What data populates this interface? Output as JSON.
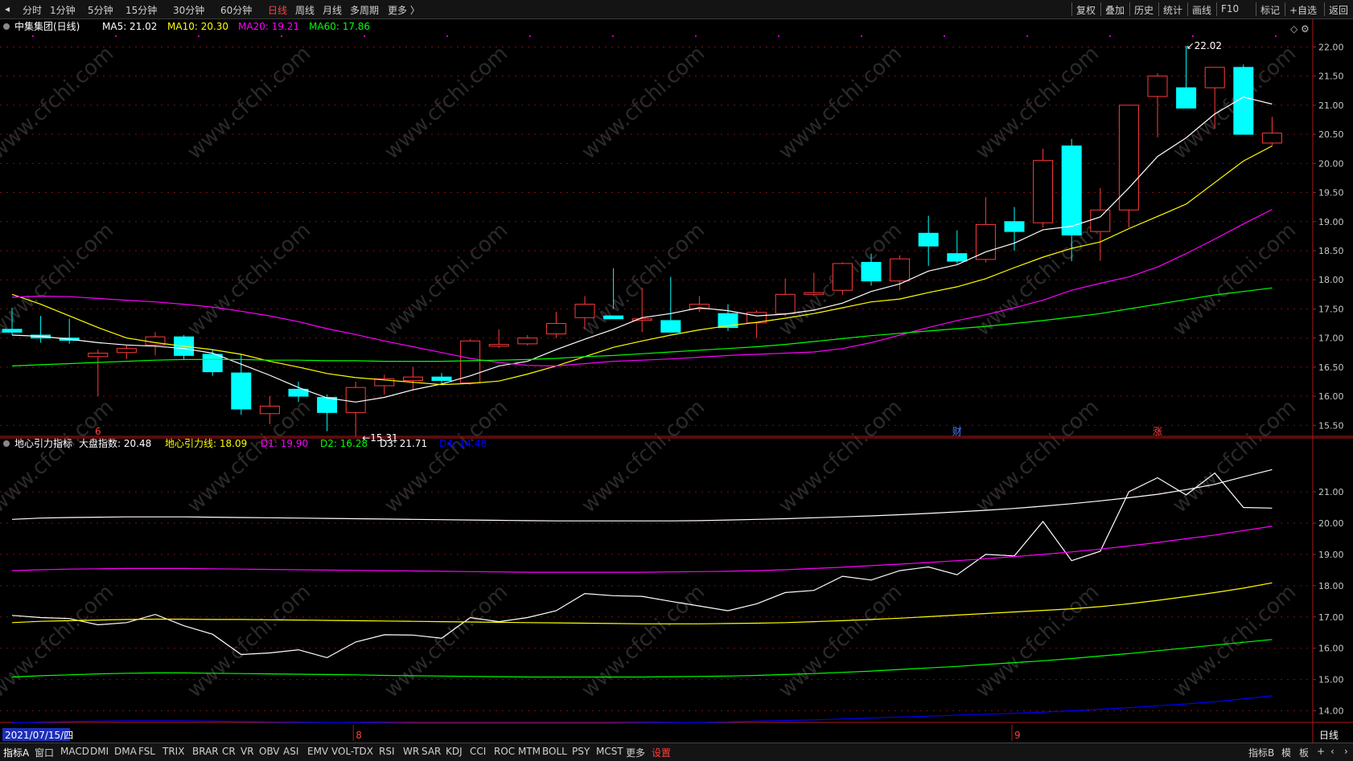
{
  "toolbar": {
    "back_glyph": "◂",
    "periods": [
      "分时",
      "1分钟",
      "5分钟",
      "15分钟",
      "30分钟",
      "60分钟",
      "日线",
      "周线",
      "月线",
      "多周期",
      "更多 〉"
    ],
    "active_period": "日线",
    "tools": [
      "复权",
      "叠加",
      "历史",
      "统计",
      "画线",
      "F10",
      "标记",
      "+自选",
      "返回"
    ]
  },
  "colors": {
    "up": "#ff3b3b",
    "down": "#00ffff",
    "grid": "#7a1111",
    "border": "#b01818",
    "ma5": "#ffffff",
    "ma10": "#ffff00",
    "ma20": "#ff00ff",
    "ma60": "#00ff00",
    "dadi": "#ffffff",
    "dixin": "#ffff00",
    "d1": "#ff00ff",
    "d2": "#00ff00",
    "d3": "#ffffff",
    "d4": "#0000ff",
    "event_red": "#ff4040",
    "event_blue": "#4a7cff"
  },
  "chart_data": [
    {
      "type": "candlestick",
      "title": "中集集团(日线)",
      "ylim": [
        15.2,
        22.2
      ],
      "yticks": [
        "22.00",
        "21.50",
        "21.00",
        "20.50",
        "20.00",
        "19.50",
        "19.00",
        "18.50",
        "18.00",
        "17.50",
        "17.00",
        "16.50",
        "16.00",
        "15.50"
      ],
      "ohlc": [
        [
          17.15,
          17.52,
          17.05,
          17.1
        ],
        [
          17.05,
          17.38,
          16.92,
          17.0
        ],
        [
          17.0,
          17.33,
          16.9,
          16.96
        ],
        [
          16.68,
          16.8,
          16.0,
          16.74
        ],
        [
          16.75,
          16.88,
          16.64,
          16.82
        ],
        [
          16.88,
          17.1,
          16.7,
          17.02
        ],
        [
          17.02,
          17.05,
          16.62,
          16.7
        ],
        [
          16.72,
          16.8,
          16.35,
          16.42
        ],
        [
          16.4,
          16.72,
          15.68,
          15.78
        ],
        [
          15.7,
          16.0,
          15.52,
          15.83
        ],
        [
          16.12,
          16.25,
          15.9,
          16.0
        ],
        [
          15.98,
          16.03,
          15.4,
          15.72
        ],
        [
          15.72,
          16.25,
          15.31,
          16.15
        ],
        [
          16.18,
          16.37,
          16.03,
          16.3
        ],
        [
          16.27,
          16.5,
          16.1,
          16.33
        ],
        [
          16.33,
          16.4,
          16.22,
          16.27
        ],
        [
          16.23,
          16.98,
          16.2,
          16.95
        ],
        [
          16.86,
          17.15,
          16.83,
          16.89
        ],
        [
          16.9,
          17.05,
          16.87,
          17.0
        ],
        [
          17.07,
          17.45,
          17.0,
          17.25
        ],
        [
          17.35,
          17.72,
          17.15,
          17.58
        ],
        [
          17.38,
          18.2,
          17.5,
          17.33
        ],
        [
          17.33,
          17.86,
          17.1,
          17.33
        ],
        [
          17.3,
          18.05,
          17.26,
          17.1
        ],
        [
          17.5,
          17.72,
          17.45,
          17.58
        ],
        [
          17.42,
          17.58,
          17.12,
          17.18
        ],
        [
          17.26,
          17.48,
          17.0,
          17.44
        ],
        [
          17.42,
          18.02,
          17.38,
          17.75
        ],
        [
          17.75,
          18.12,
          17.72,
          17.78
        ],
        [
          17.82,
          18.3,
          17.74,
          18.28
        ],
        [
          18.3,
          18.45,
          17.9,
          17.98
        ],
        [
          17.98,
          18.42,
          17.82,
          18.36
        ],
        [
          18.8,
          19.1,
          18.24,
          18.58
        ],
        [
          18.45,
          18.85,
          18.28,
          18.32
        ],
        [
          18.35,
          19.42,
          18.3,
          18.95
        ],
        [
          19.0,
          19.25,
          18.5,
          18.83
        ],
        [
          18.98,
          20.25,
          18.9,
          20.05
        ],
        [
          20.3,
          20.42,
          18.32,
          18.77
        ],
        [
          18.83,
          19.58,
          18.33,
          19.2
        ],
        [
          19.2,
          21.0,
          18.9,
          21.0
        ],
        [
          21.15,
          21.55,
          20.45,
          21.5
        ],
        [
          21.3,
          22.02,
          20.95,
          20.95
        ],
        [
          21.3,
          21.65,
          20.6,
          21.65
        ],
        [
          21.65,
          21.7,
          20.5,
          20.5
        ],
        [
          20.35,
          20.8,
          20.3,
          20.52
        ]
      ],
      "series": [
        {
          "name": "MA5",
          "last": "21.02",
          "values": [
            17.05,
            17.03,
            16.98,
            16.92,
            16.88,
            16.86,
            16.82,
            16.74,
            16.55,
            16.36,
            16.15,
            15.97,
            15.9,
            15.98,
            16.11,
            16.21,
            16.35,
            16.52,
            16.6,
            16.8,
            16.98,
            17.15,
            17.35,
            17.42,
            17.52,
            17.47,
            17.38,
            17.41,
            17.48,
            17.6,
            17.8,
            17.93,
            18.15,
            18.26,
            18.48,
            18.63,
            18.86,
            18.92,
            19.08,
            19.58,
            20.12,
            20.44,
            20.85,
            21.14,
            21.02
          ]
        },
        {
          "name": "MA10",
          "last": "20.30",
          "values": [
            17.75,
            17.58,
            17.38,
            17.18,
            17.0,
            16.92,
            16.86,
            16.8,
            16.72,
            16.6,
            16.5,
            16.39,
            16.32,
            16.28,
            16.24,
            16.2,
            16.22,
            16.26,
            16.38,
            16.52,
            16.68,
            16.84,
            16.95,
            17.05,
            17.14,
            17.21,
            17.27,
            17.34,
            17.42,
            17.52,
            17.62,
            17.67,
            17.78,
            17.88,
            18.02,
            18.21,
            18.39,
            18.54,
            18.65,
            18.88,
            19.09,
            19.3,
            19.67,
            20.04,
            20.3
          ]
        },
        {
          "name": "MA20",
          "last": "19.21",
          "values": [
            17.7,
            17.72,
            17.71,
            17.68,
            17.65,
            17.62,
            17.58,
            17.53,
            17.46,
            17.38,
            17.28,
            17.16,
            17.06,
            16.95,
            16.85,
            16.75,
            16.65,
            16.58,
            16.53,
            16.52,
            16.56,
            16.6,
            16.62,
            16.64,
            16.67,
            16.7,
            16.72,
            16.74,
            16.76,
            16.82,
            16.92,
            17.05,
            17.18,
            17.3,
            17.4,
            17.52,
            17.65,
            17.82,
            17.94,
            18.05,
            18.22,
            18.45,
            18.7,
            18.96,
            19.21
          ]
        },
        {
          "name": "MA60",
          "last": "17.86",
          "values": [
            16.52,
            16.54,
            16.56,
            16.58,
            16.6,
            16.62,
            16.63,
            16.63,
            16.63,
            16.62,
            16.62,
            16.61,
            16.61,
            16.6,
            16.6,
            16.6,
            16.61,
            16.62,
            16.63,
            16.65,
            16.68,
            16.7,
            16.73,
            16.76,
            16.79,
            16.82,
            16.85,
            16.89,
            16.94,
            16.99,
            17.04,
            17.08,
            17.12,
            17.16,
            17.2,
            17.25,
            17.3,
            17.36,
            17.42,
            17.5,
            17.58,
            17.66,
            17.74,
            17.8,
            17.86
          ]
        }
      ],
      "annotations": {
        "high": "22.02",
        "low": "15.31",
        "high_marker": "↙",
        "low_marker": "←"
      },
      "events": [
        {
          "index": 3,
          "label": "6",
          "color": "event_red"
        },
        {
          "index": 33,
          "label": "财",
          "color": "event_blue"
        },
        {
          "index": 40,
          "label": "涨",
          "color": "event_red"
        }
      ]
    },
    {
      "type": "line",
      "title": "地心引力指标",
      "ylim": [
        13.5,
        21.9
      ],
      "yticks": [
        "21.00",
        "20.00",
        "19.00",
        "18.00",
        "17.00",
        "16.00",
        "15.00",
        "14.00"
      ],
      "series": [
        {
          "name": "大盘指数",
          "last": "20.48",
          "values": [
            17.05,
            16.98,
            16.95,
            16.75,
            16.82,
            17.08,
            16.72,
            16.45,
            15.8,
            15.85,
            15.95,
            15.7,
            16.2,
            16.43,
            16.42,
            16.32,
            16.98,
            16.85,
            16.98,
            17.2,
            17.75,
            17.68,
            17.66,
            17.5,
            17.35,
            17.2,
            17.42,
            17.78,
            17.85,
            18.3,
            18.18,
            18.48,
            18.6,
            18.35,
            19.0,
            18.95,
            20.05,
            18.8,
            19.1,
            21.0,
            21.45,
            20.9,
            21.6,
            20.5,
            20.48
          ]
        },
        {
          "name": "地心引力线",
          "last": "18.09",
          "values": [
            16.82,
            16.86,
            16.88,
            16.9,
            16.92,
            16.93,
            16.93,
            16.92,
            16.92,
            16.91,
            16.9,
            16.89,
            16.88,
            16.87,
            16.86,
            16.85,
            16.84,
            16.83,
            16.82,
            16.81,
            16.8,
            16.79,
            16.78,
            16.78,
            16.78,
            16.79,
            16.8,
            16.82,
            16.85,
            16.88,
            16.92,
            16.96,
            17.01,
            17.06,
            17.11,
            17.16,
            17.21,
            17.26,
            17.33,
            17.42,
            17.53,
            17.65,
            17.78,
            17.92,
            18.09
          ]
        },
        {
          "name": "D1",
          "last": "19.90",
          "values": [
            18.48,
            18.51,
            18.53,
            18.54,
            18.55,
            18.55,
            18.55,
            18.54,
            18.53,
            18.52,
            18.51,
            18.5,
            18.49,
            18.48,
            18.47,
            18.46,
            18.45,
            18.44,
            18.43,
            18.43,
            18.43,
            18.43,
            18.43,
            18.44,
            18.45,
            18.46,
            18.48,
            18.51,
            18.55,
            18.59,
            18.64,
            18.69,
            18.74,
            18.8,
            18.86,
            18.93,
            19.0,
            19.08,
            19.17,
            19.27,
            19.38,
            19.5,
            19.62,
            19.76,
            19.9
          ]
        },
        {
          "name": "D2",
          "last": "16.28",
          "values": [
            15.08,
            15.12,
            15.15,
            15.18,
            15.2,
            15.21,
            15.21,
            15.2,
            15.19,
            15.18,
            15.17,
            15.16,
            15.15,
            15.13,
            15.12,
            15.11,
            15.1,
            15.09,
            15.08,
            15.08,
            15.08,
            15.08,
            15.08,
            15.09,
            15.1,
            15.11,
            15.13,
            15.16,
            15.19,
            15.23,
            15.27,
            15.32,
            15.37,
            15.42,
            15.48,
            15.54,
            15.6,
            15.67,
            15.75,
            15.83,
            15.92,
            16.01,
            16.1,
            16.19,
            16.28
          ]
        },
        {
          "name": "D3",
          "last": "21.71",
          "values": [
            20.12,
            20.16,
            20.18,
            20.19,
            20.2,
            20.2,
            20.2,
            20.19,
            20.18,
            20.17,
            20.16,
            20.15,
            20.14,
            20.13,
            20.12,
            20.11,
            20.1,
            20.09,
            20.08,
            20.07,
            20.07,
            20.07,
            20.07,
            20.07,
            20.08,
            20.1,
            20.12,
            20.14,
            20.17,
            20.2,
            20.23,
            20.27,
            20.31,
            20.36,
            20.41,
            20.47,
            20.54,
            20.62,
            20.71,
            20.81,
            20.92,
            21.07,
            21.24,
            21.48,
            21.71
          ]
        },
        {
          "name": "D4",
          "last": "14.48",
          "values": [
            13.62,
            13.64,
            13.66,
            13.67,
            13.68,
            13.68,
            13.68,
            13.67,
            13.66,
            13.65,
            13.64,
            13.63,
            13.62,
            13.61,
            13.6,
            13.6,
            13.6,
            13.6,
            13.6,
            13.6,
            13.6,
            13.6,
            13.61,
            13.62,
            13.63,
            13.65,
            13.67,
            13.69,
            13.71,
            13.74,
            13.77,
            13.8,
            13.83,
            13.86,
            13.89,
            13.92,
            13.96,
            14.0,
            14.05,
            14.1,
            14.16,
            14.22,
            14.29,
            14.38,
            14.48
          ]
        }
      ]
    }
  ],
  "xaxis": {
    "date": "2021/07/15/四",
    "markers": [
      {
        "index": 12,
        "label": "8"
      },
      {
        "index": 35,
        "label": "9"
      }
    ],
    "right_label": "日线"
  },
  "watermark": "www.cfchi.com",
  "bottom_tabs": [
    "指标A",
    "窗口",
    "MACD",
    "DMI",
    "DMA",
    "FSL",
    "TRIX",
    "BRAR",
    "CR",
    "VR",
    "OBV",
    "ASI",
    "EMV",
    "VOL-TDX",
    "RSI",
    "WR",
    "SAR",
    "KDJ",
    "CCI",
    "ROC",
    "MTM",
    "BOLL",
    "PSY",
    "MCST",
    "更多",
    "设置"
  ],
  "bottom_right": [
    "指标B",
    "模",
    "板",
    "+",
    "‹",
    "›"
  ]
}
